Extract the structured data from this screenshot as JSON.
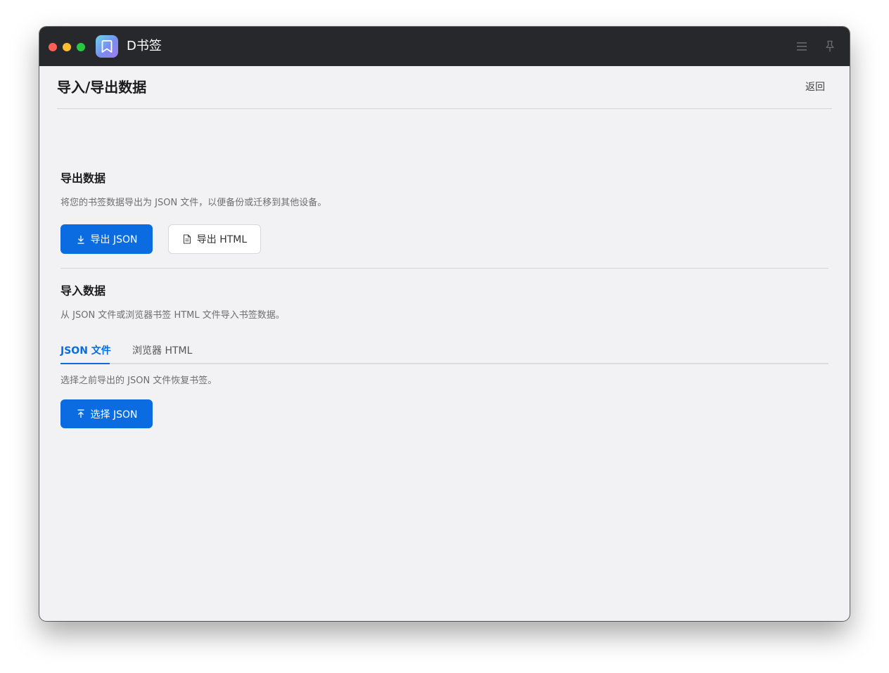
{
  "app": {
    "title": "D书签",
    "logo_icon": "bookmark-icon",
    "colors": {
      "titlebar": "#27282b",
      "accent": "#0a6ce0",
      "background": "#f2f2f4"
    }
  },
  "titlebar": {
    "menu_icon": "menu-icon",
    "pin_icon": "pin-icon"
  },
  "header": {
    "title": "导入/导出数据",
    "back_label": "返回"
  },
  "export_section": {
    "title": "导出数据",
    "description": "将您的书签数据导出为 JSON 文件，以便备份或迁移到其他设备。",
    "export_json_label": "导出 JSON",
    "export_html_label": "导出 HTML"
  },
  "import_section": {
    "title": "导入数据",
    "description": "从 JSON 文件或浏览器书签 HTML 文件导入书签数据。",
    "tabs": [
      {
        "label": "JSON 文件",
        "active": true
      },
      {
        "label": "浏览器 HTML",
        "active": false
      }
    ],
    "tab_description": "选择之前导出的 JSON 文件恢复书签。",
    "select_json_label": "选择 JSON"
  }
}
